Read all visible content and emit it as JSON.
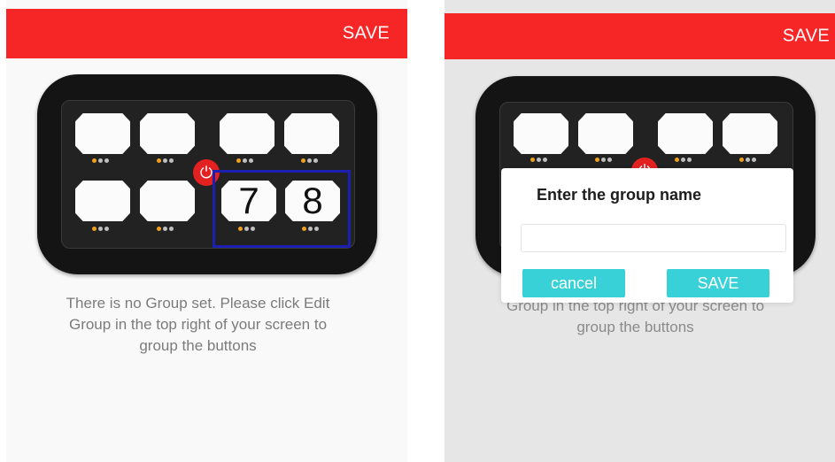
{
  "left_screen": {
    "header": {
      "save_label": "SAVE"
    },
    "numbered_buttons": {
      "b7": "7",
      "b8": "8"
    },
    "info_text": "There is no Group set. Please click Edit\nGroup in the top right of your screen to\ngroup the buttons"
  },
  "right_screen": {
    "header": {
      "save_label": "SAVE"
    },
    "info_text_partial": "Th                                                          \nGroup in the top right of your screen to\ngroup the buttons",
    "dialog": {
      "title": "Enter the group name",
      "input_value": "",
      "input_placeholder": "",
      "cancel_label": "cancel",
      "save_label": "SAVE"
    }
  },
  "colors": {
    "header_bg": "#f62626",
    "accent_teal": "#39d1d8",
    "device_body": "#141414",
    "power_red": "#e42121",
    "led_amber": "#f1a11e",
    "highlight_blue": "#1c20b0"
  },
  "icons": [
    "power-icon"
  ]
}
